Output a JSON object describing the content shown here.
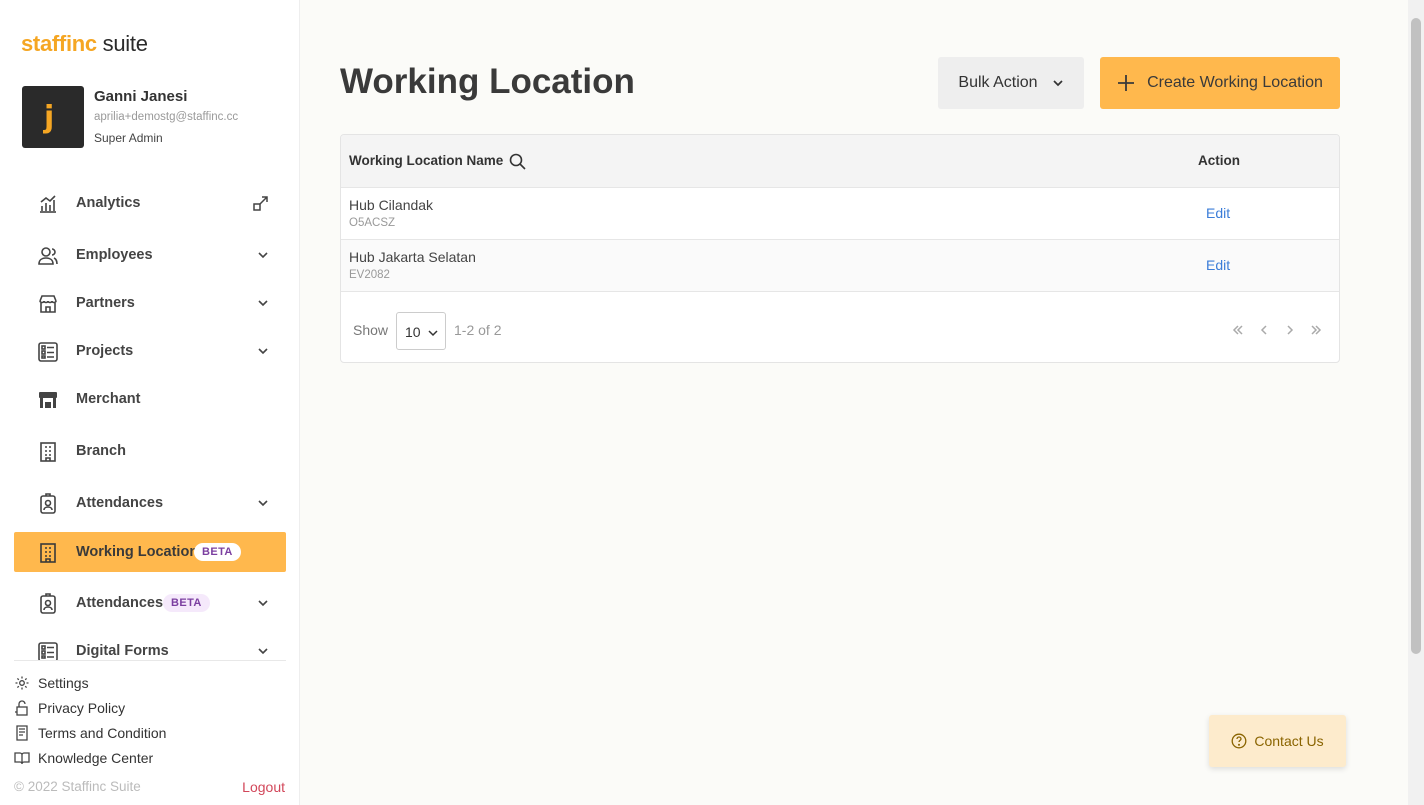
{
  "brand": {
    "logo_brand": "staffinc",
    "logo_suite": "suite",
    "accent": "#ffb84d"
  },
  "profile": {
    "name": "Ganni Janesi",
    "email": "aprilia+demostg@staffinc.cc",
    "role": "Super Admin"
  },
  "sidebar": {
    "items": [
      {
        "label": "Analytics",
        "icon": "analytics-icon",
        "trailing": "external-link-icon"
      },
      {
        "label": "Employees",
        "icon": "employees-icon",
        "trailing": "chevron-down-icon"
      },
      {
        "label": "Partners",
        "icon": "store-icon",
        "trailing": "chevron-down-icon"
      },
      {
        "label": "Projects",
        "icon": "list-icon",
        "trailing": "chevron-down-icon"
      },
      {
        "label": "Merchant",
        "icon": "merchant-icon"
      },
      {
        "label": "Branch",
        "icon": "building-icon"
      },
      {
        "label": "Attendances",
        "icon": "badge-icon",
        "trailing": "chevron-down-icon"
      },
      {
        "label": "Working Location",
        "icon": "building-icon",
        "badge": "BETA",
        "active": true
      },
      {
        "label": "Attendances",
        "icon": "badge-icon",
        "badge": "BETA",
        "trailing": "chevron-down-icon"
      },
      {
        "label": "Digital Forms",
        "icon": "list-icon",
        "trailing": "chevron-down-icon"
      }
    ]
  },
  "footer": {
    "links": [
      "Settings",
      "Privacy Policy",
      "Terms and Condition",
      "Knowledge Center"
    ],
    "copyright": "© 2022 Staffinc Suite",
    "logout": "Logout"
  },
  "main": {
    "title": "Working Location",
    "bulk_action": "Bulk Action",
    "create_button": "Create Working Location"
  },
  "table": {
    "columns": [
      "Working Location Name",
      "Action"
    ],
    "rows": [
      {
        "name": "Hub Cilandak",
        "code": "O5ACSZ",
        "action": "Edit"
      },
      {
        "name": "Hub Jakarta Selatan",
        "code": "EV2082",
        "action": "Edit"
      }
    ]
  },
  "pagination": {
    "show_label": "Show",
    "page_size": "10",
    "range": "1-2 of 2"
  },
  "contact": {
    "label": "Contact Us"
  }
}
